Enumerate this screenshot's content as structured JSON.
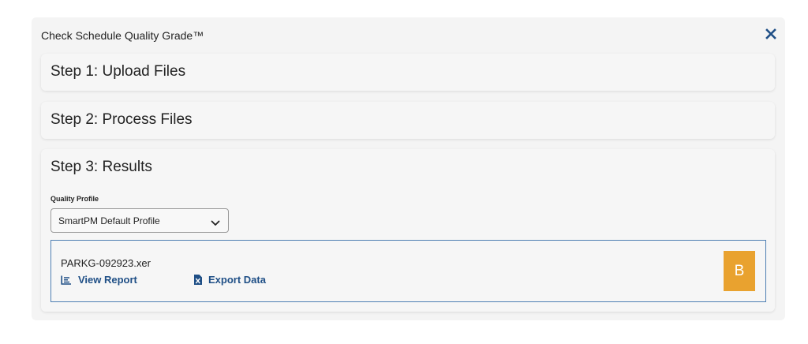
{
  "modal": {
    "title": "Check Schedule Quality Grade™",
    "close_icon": "close-x-icon"
  },
  "steps": [
    {
      "label": "Step 1: Upload Files"
    },
    {
      "label": "Step 2: Process Files"
    },
    {
      "label": "Step 3: Results"
    }
  ],
  "results": {
    "profile_label": "Quality Profile",
    "profile_selected": "SmartPM Default Profile",
    "file": {
      "name": "PARKG-092923.xer",
      "view_report_label": "View Report",
      "view_report_icon": "report-list-icon",
      "export_data_label": "Export Data",
      "export_data_icon": "excel-file-icon",
      "grade": "B"
    }
  },
  "colors": {
    "accent": "#1f4f86",
    "card_border": "#4f7fb3",
    "grade_badge": "#e9a22f",
    "panel_bg": "#f4f4f4"
  }
}
